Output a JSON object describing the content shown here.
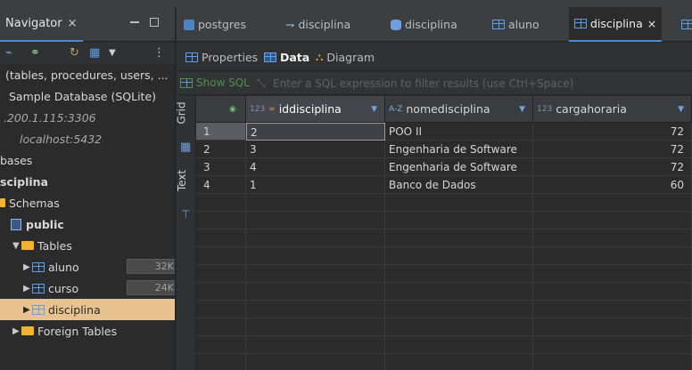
{
  "navigator": {
    "tab_label": "Navigator",
    "tab_close": "×",
    "rows": [
      {
        "text": "(tables, procedures, users, ...",
        "style": ""
      },
      {
        "text": "Sample Database (SQLite)",
        "style": ""
      },
      {
        "text": ".200.1.115:3306",
        "style": "italic"
      },
      {
        "text": "localhost:5432",
        "style": "italic"
      },
      {
        "text": "bases",
        "style": ""
      },
      {
        "text": "sciplina",
        "style": "bold"
      },
      {
        "text": "Schemas",
        "style": ""
      },
      {
        "text": "public",
        "style": "bold"
      },
      {
        "text": "Tables",
        "style": ""
      },
      {
        "text": "aluno",
        "style": ""
      },
      {
        "text": "curso",
        "style": ""
      },
      {
        "text": "disciplina",
        "style": "selected"
      },
      {
        "text": "Foreign Tables",
        "style": ""
      }
    ],
    "sizes": {
      "aluno": "32K",
      "curso": "24K"
    }
  },
  "editor_tabs": [
    {
      "label": "postgres",
      "icon": "postgres-icon"
    },
    {
      "label": "disciplina",
      "icon": "view-icon"
    },
    {
      "label": "disciplina",
      "icon": "database-icon"
    },
    {
      "label": "aluno",
      "icon": "table-icon"
    },
    {
      "label": "disciplina",
      "icon": "table-icon",
      "active": true,
      "close": "×"
    }
  ],
  "subtabs": {
    "properties": "Properties",
    "data": "Data",
    "diagram": "Diagram"
  },
  "filter": {
    "show_sql": "Show SQL",
    "placeholder": "Enter a SQL expression to filter results (use Ctrl+Space)"
  },
  "side": {
    "grid": "Grid",
    "text": "Text"
  },
  "grid": {
    "columns": [
      {
        "type": "123",
        "key": "∞",
        "name": "iddisciplina"
      },
      {
        "type": "A-Z",
        "name": "nomedisciplina"
      },
      {
        "type": "123",
        "name": "cargahoraria"
      }
    ],
    "rows": [
      {
        "n": "1",
        "id": "2",
        "nome": "POO II",
        "carga": "72"
      },
      {
        "n": "2",
        "id": "3",
        "nome": "Engenharia de Software",
        "carga": "72"
      },
      {
        "n": "3",
        "id": "4",
        "nome": "Engenharia de Software",
        "carga": "72"
      },
      {
        "n": "4",
        "id": "1",
        "nome": "Banco de Dados",
        "carga": "60"
      }
    ]
  },
  "colors": {
    "selection": "#e8c38f",
    "accent": "#4b8cd9",
    "table_icon": "#5ba0e6",
    "folder": "#f0b430"
  }
}
